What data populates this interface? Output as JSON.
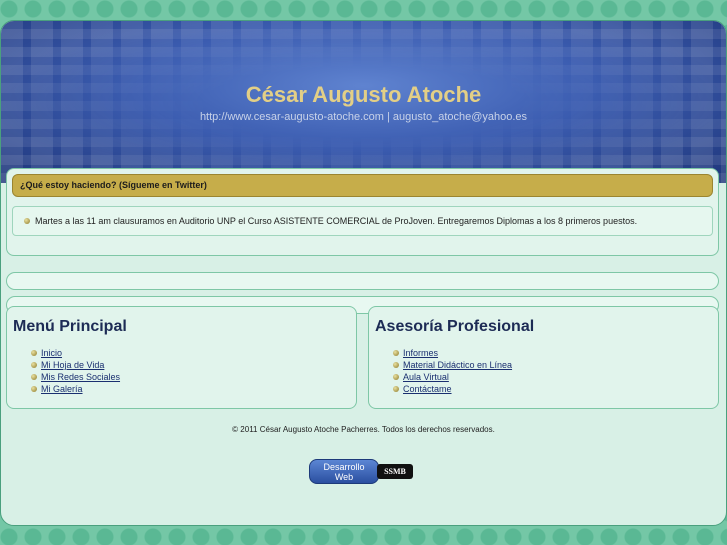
{
  "header": {
    "title": "César Augusto Atoche",
    "subtitle": "http://www.cesar-augusto-atoche.com | augusto_atoche@yahoo.es"
  },
  "twitter": {
    "heading": "¿Qué estoy haciendo? (Sígueme en Twitter)",
    "tweet": "Martes a las 11 am clausuramos en Auditorio UNP el Curso ASISTENTE COMERCIAL de ProJoven. Entregaremos Diplomas a los 8 primeros puestos."
  },
  "menu_principal": {
    "title": "Menú Principal",
    "items": [
      {
        "label": "Inicio"
      },
      {
        "label": "Mi Hoja de Vida"
      },
      {
        "label": "Mis Redes Sociales"
      },
      {
        "label": "Mi Galería"
      }
    ]
  },
  "asesoria": {
    "title": "Asesoría Profesional",
    "items": [
      {
        "label": "Informes"
      },
      {
        "label": "Material Didáctico en Línea"
      },
      {
        "label": "Aula Virtual"
      },
      {
        "label": "Contáctame"
      }
    ]
  },
  "footer": {
    "copyright": "© 2011 César Augusto Atoche Pacherres. Todos los derechos reservados.",
    "badge_line1": "Desarrollo",
    "badge_line2": "Web",
    "logo_text": "SSMB"
  },
  "colors": {
    "background": "#74c7a6",
    "header_blue": "#3b5cb0",
    "title_gold": "#e3cf86",
    "twitter_bar": "#c6ad4a",
    "link": "#1a2f70"
  }
}
